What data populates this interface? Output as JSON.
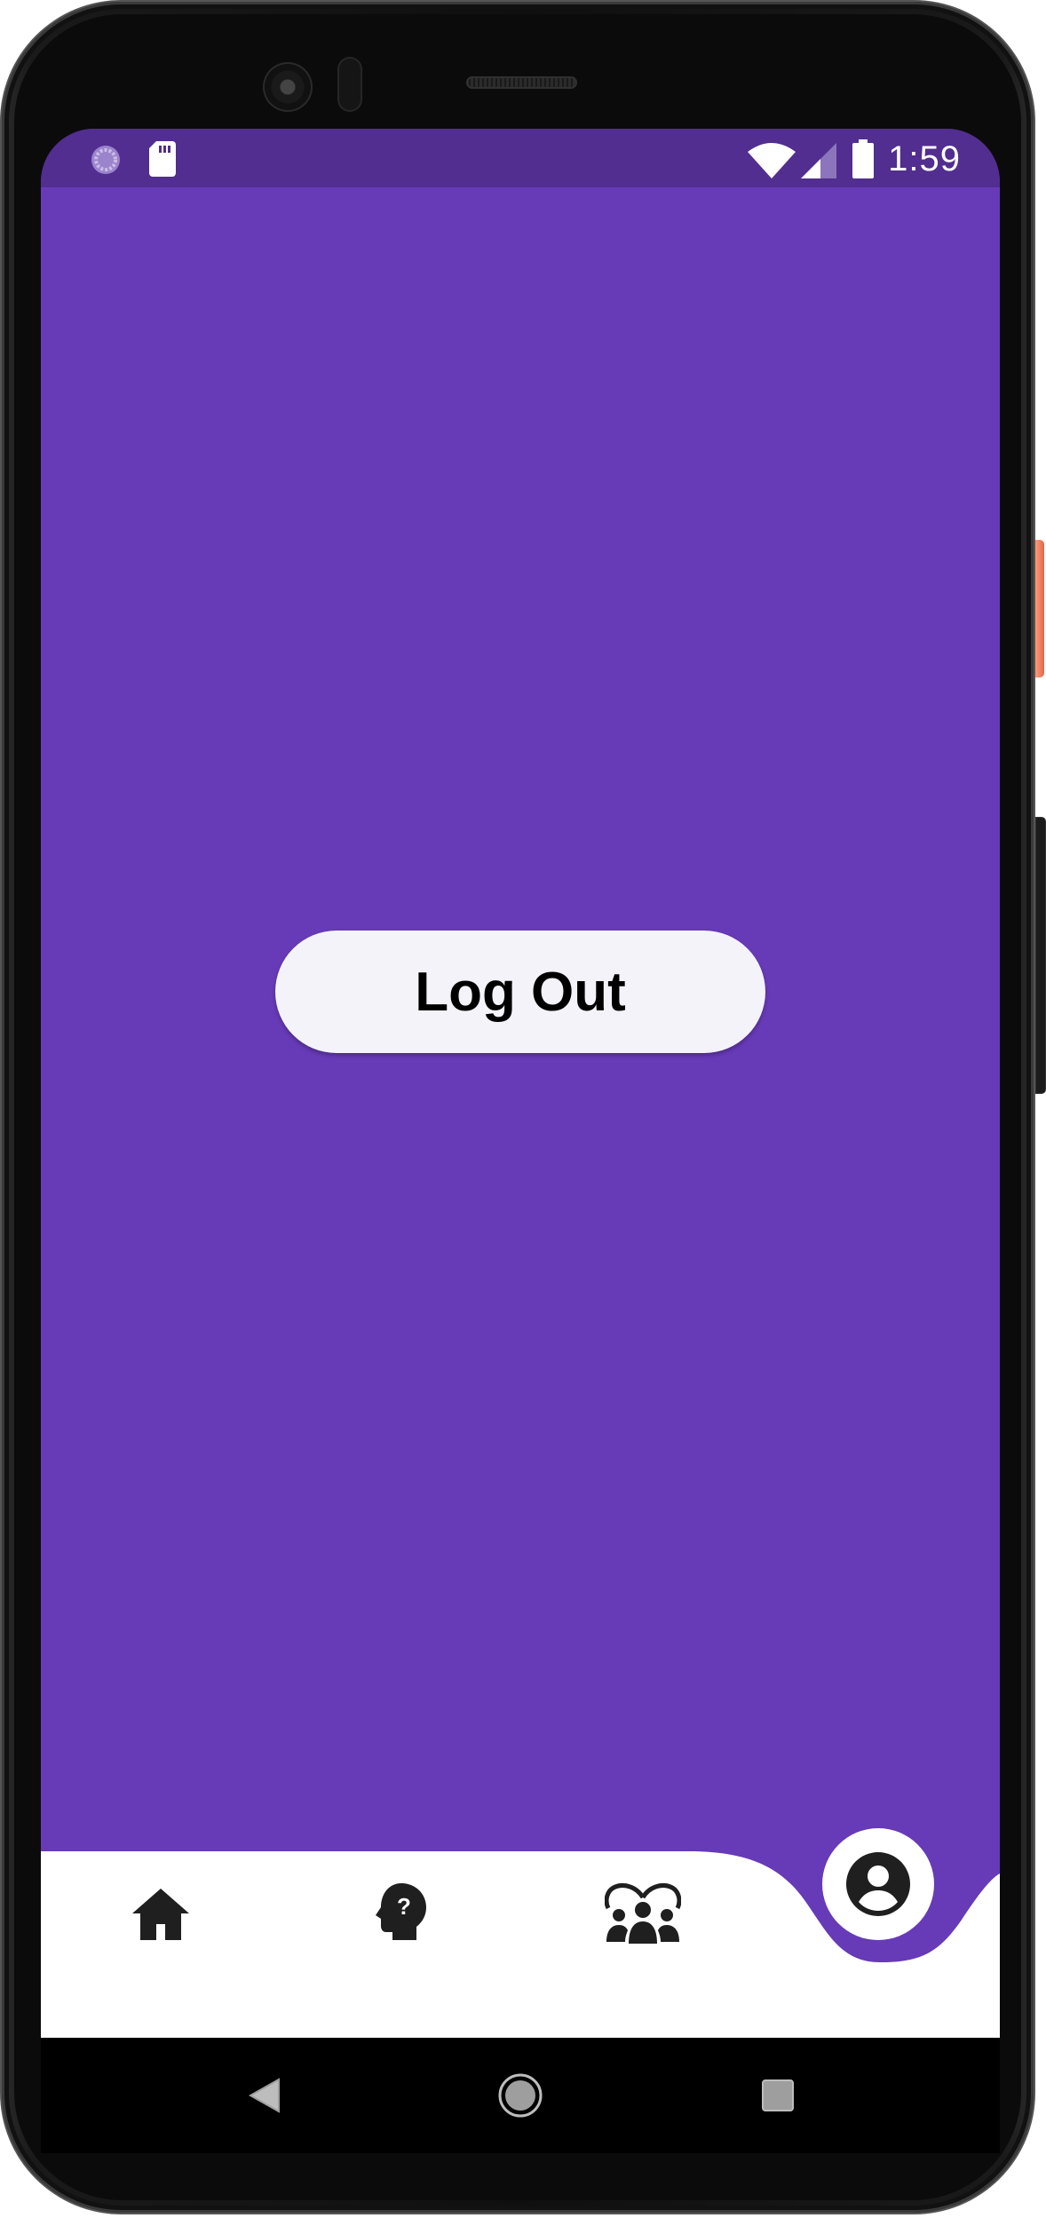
{
  "status_bar": {
    "time": "1:59",
    "left_icons": [
      "loading-spinner-icon",
      "sd-card-icon"
    ],
    "right_icons": [
      "wifi-icon",
      "cell-signal-icon",
      "battery-icon"
    ]
  },
  "main": {
    "logout_label": "Log Out"
  },
  "bottom_nav": {
    "items": [
      {
        "icon": "home-icon"
      },
      {
        "icon": "head-question-icon"
      },
      {
        "icon": "community-icon"
      },
      {
        "icon": "account-circle-icon",
        "active": true
      }
    ]
  },
  "system_nav": {
    "buttons": [
      "back-icon",
      "home-circle-icon",
      "recents-icon"
    ]
  },
  "colors": {
    "primary": "#673ab7",
    "status_bar": "#512e8f",
    "button_bg": "#f4f3f9",
    "nav_bg": "#ffffff",
    "icon": "#1f1f1f"
  }
}
